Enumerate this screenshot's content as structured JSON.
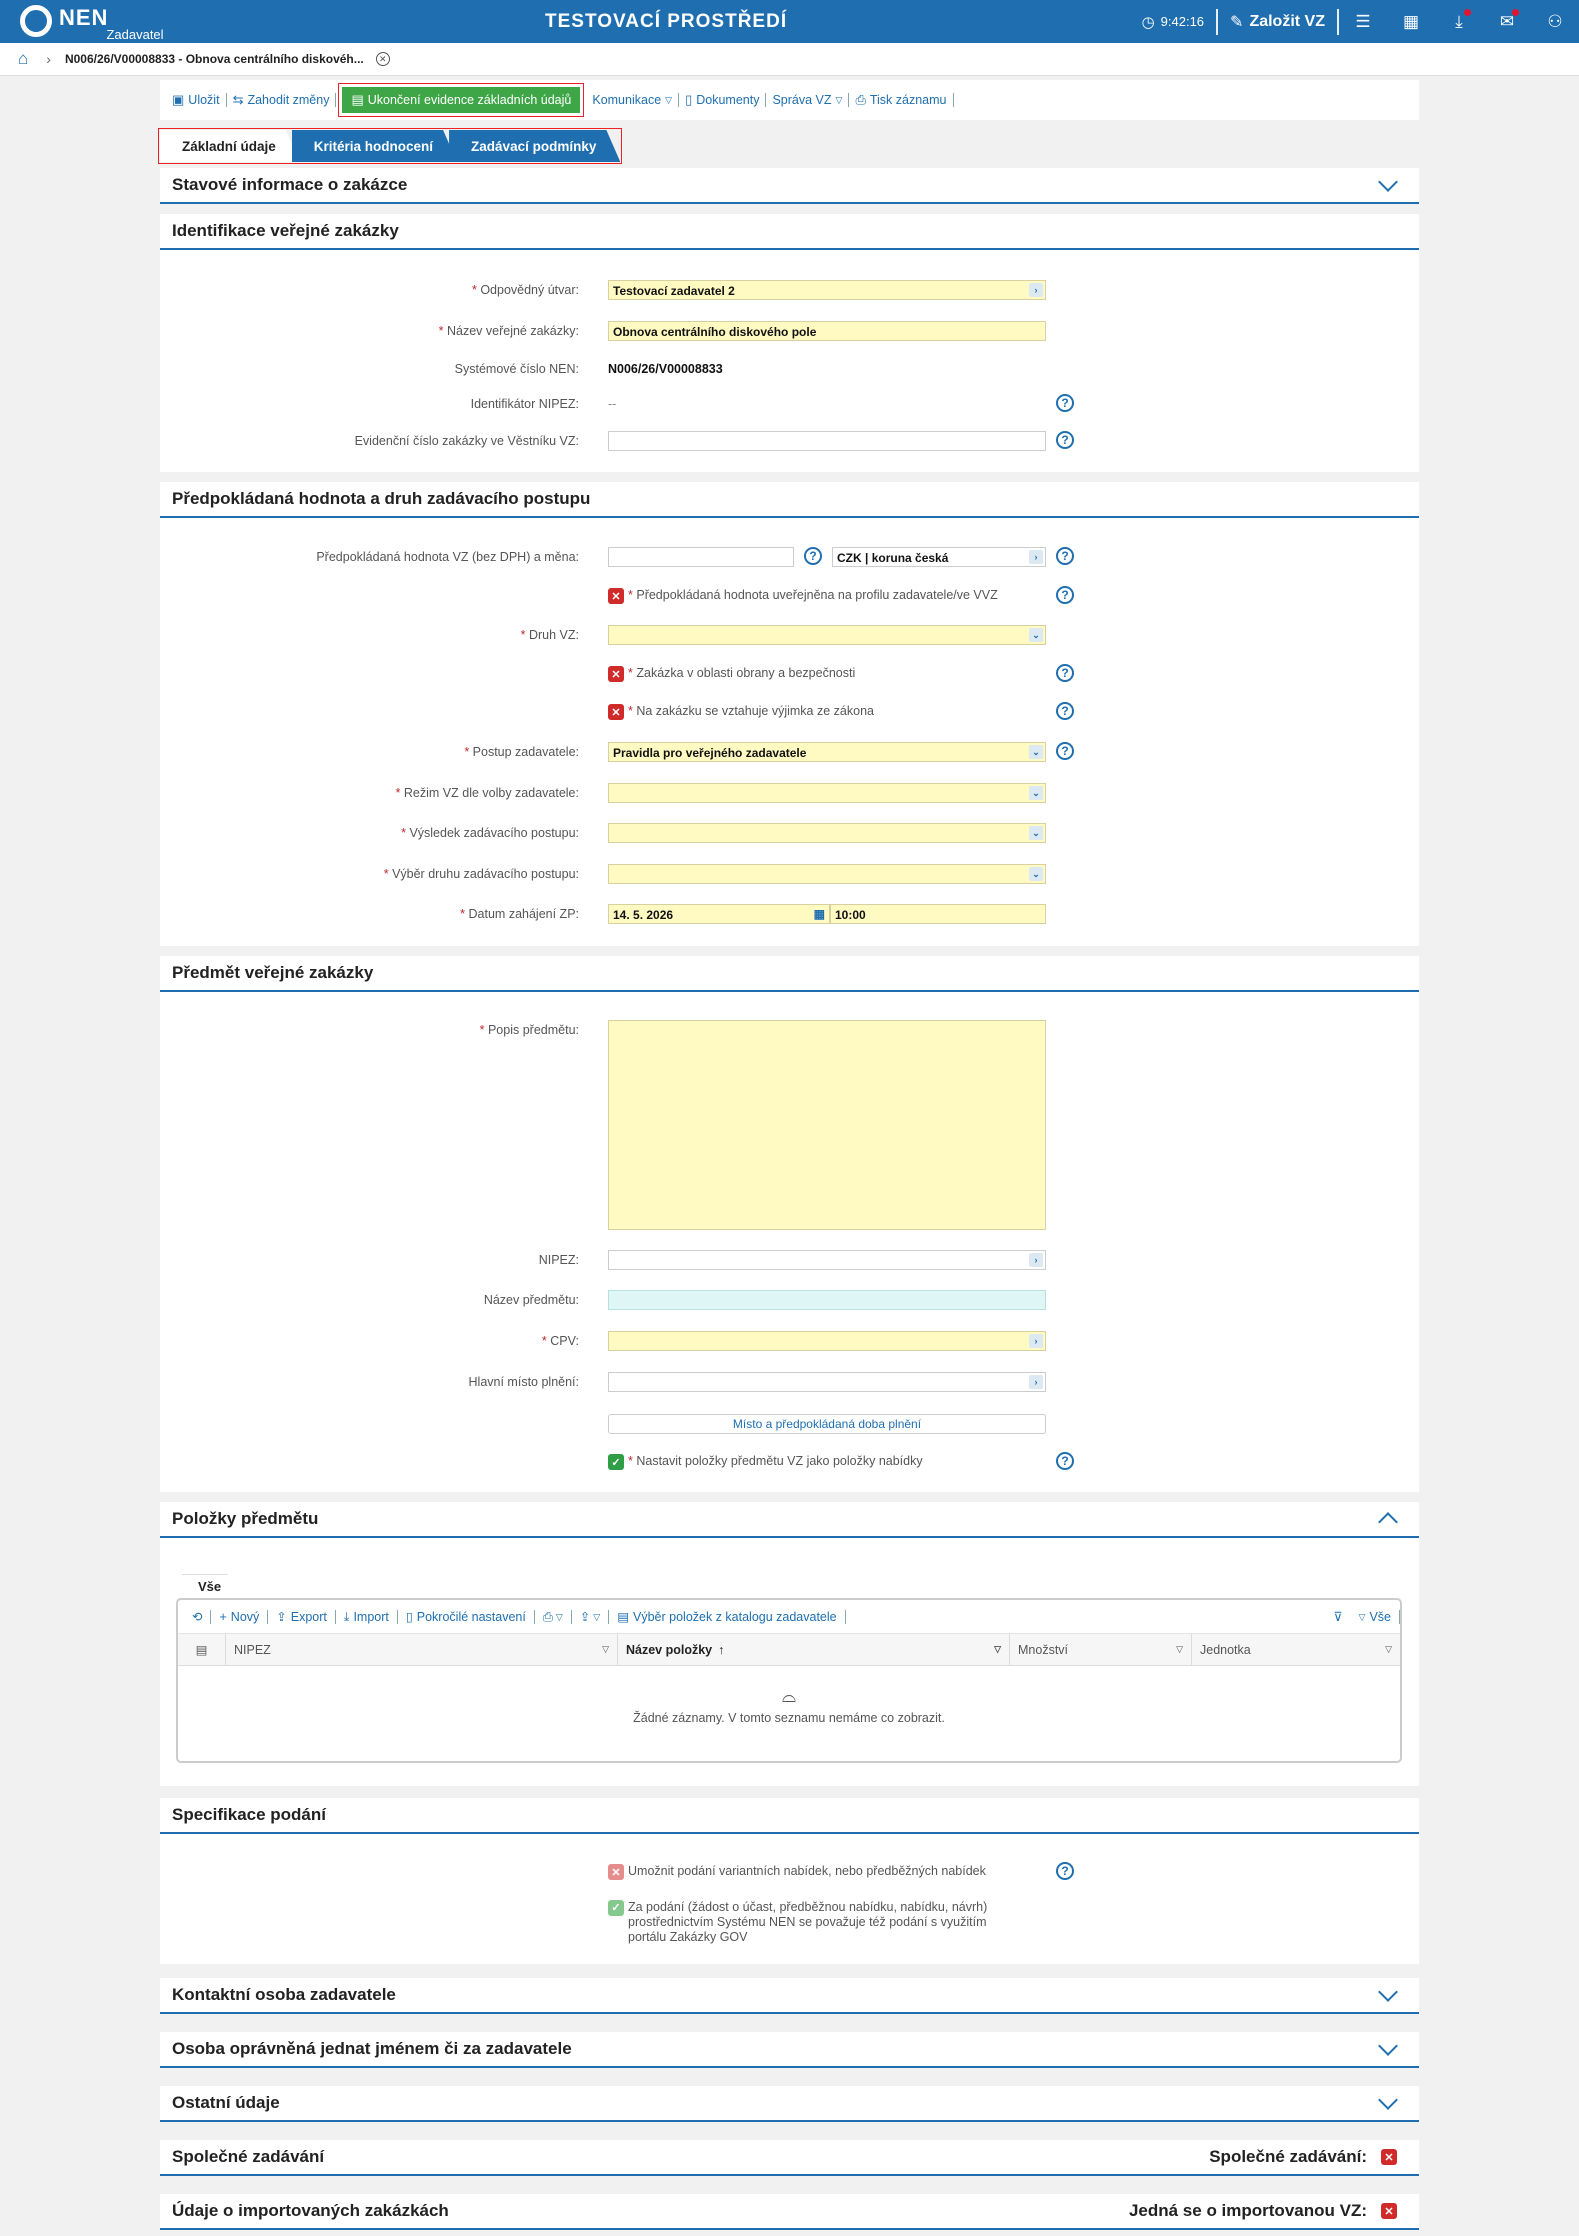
{
  "header": {
    "logo": "NEN",
    "logo_sub": "Zadavatel",
    "env_title": "TESTOVACÍ PROSTŘEDÍ",
    "time": "9:42:16",
    "create_label": "Založit VZ"
  },
  "breadcrumb": {
    "item": "N006/26/V00008833 - Obnova centrálního diskovéh..."
  },
  "toolbar": {
    "save": "Uložit",
    "discard": "Zahodit změny",
    "finish": "Ukončení evidence základních údajů",
    "comm": "Komunikace",
    "docs": "Dokumenty",
    "admin": "Správa VZ",
    "print": "Tisk záznamu"
  },
  "tabs": [
    "Základní údaje",
    "Kritéria hodnocení",
    "Zadávací podmínky"
  ],
  "stav": {
    "title": "Stavové informace o zakázce"
  },
  "ident": {
    "title": "Identifikace veřejné zakázky",
    "l_utvar": "Odpovědný útvar:",
    "v_utvar": "Testovací zadavatel 2",
    "l_nazev": "Název veřejné zakázky:",
    "v_nazev": "Obnova centrálního diskového pole",
    "l_syscis": "Systémové číslo NEN:",
    "v_syscis": "N006/26/V00008833",
    "l_nipez": "Identifikátor NIPEZ:",
    "v_nipez": "--",
    "l_evid": "Evidenční číslo zakázky ve Věstníku VZ:"
  },
  "hodnota": {
    "title": "Předpokládaná hodnota a druh zadávacího postupu",
    "l_hodnota": "Předpokládaná hodnota VZ (bez DPH) a měna:",
    "v_mena": "CZK | koruna česká",
    "c_uverejnena": "Předpokládaná hodnota uveřejněna na profilu zadavatele/ve VVZ",
    "l_druh": "Druh VZ:",
    "c_obrana": "Zakázka v oblasti obrany a bezpečnosti",
    "c_vyjimka": "Na zakázku se vztahuje výjimka ze zákona",
    "l_postup": "Postup zadavatele:",
    "v_postup": "Pravidla pro veřejného zadavatele",
    "l_rezim": "Režim VZ dle volby zadavatele:",
    "l_vysledek": "Výsledek zadávacího postupu:",
    "l_vyber": "Výběr druhu zadávacího postupu:",
    "l_datum": "Datum zahájení ZP:",
    "v_datum": "14. 5. 2026",
    "v_cas": "10:00"
  },
  "predmet": {
    "title": "Předmět veřejné zakázky",
    "l_popis": "Popis předmětu:",
    "l_nipez": "NIPEZ:",
    "l_nazev": "Název předmětu:",
    "l_cpv": "CPV:",
    "l_misto": "Hlavní místo plnění:",
    "btn_misto": "Místo a předpokládaná doba plnění",
    "c_polozky": "Nastavit položky předmětu VZ jako položky nabídky"
  },
  "polozky": {
    "title": "Položky předmětu",
    "tab": "Vše",
    "tools": {
      "new": "Nový",
      "export": "Export",
      "import": "Import",
      "advanced": "Pokročilé nastavení",
      "catalog": "Výběr položek z katalogu zadavatele",
      "all": "Vše"
    },
    "columns": [
      "NIPEZ",
      "Název položky",
      "Množství",
      "Jednotka"
    ],
    "empty": "Žádné záznamy. V tomto seznamu nemáme co zobrazit."
  },
  "spec": {
    "title": "Specifikace podání",
    "c_varianty": "Umožnit podání variantních nabídek, nebo předběžných nabídek",
    "c_gov": "Za podání (žádost o účast, předběžnou nabídku, nabídku, návrh) prostřednictvím Systému NEN se považuje též podání s využitím portálu Zakázky GOV"
  },
  "kontakt": {
    "title": "Kontaktní osoba zadavatele"
  },
  "osoba": {
    "title": "Osoba oprávněná jednat jménem či za zadavatele"
  },
  "ostatni": {
    "title": "Ostatní údaje"
  },
  "spolecne": {
    "title": "Společné zadávání",
    "right": "Společné zadávání:"
  },
  "import": {
    "title": "Údaje o importovaných zakázkách",
    "right": "Jedná se o importovanou VZ:"
  }
}
